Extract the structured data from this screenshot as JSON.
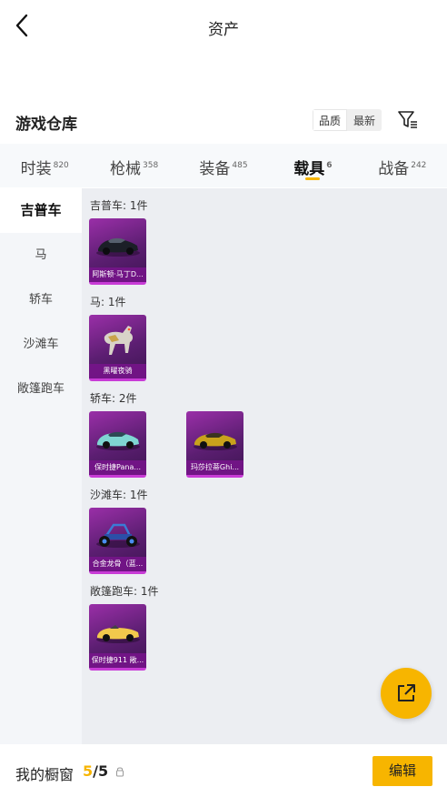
{
  "header": {
    "title": "资产"
  },
  "warehouse": {
    "title": "游戏仓库",
    "sort_quality": "品质",
    "sort_latest": "最新"
  },
  "tabs": [
    {
      "label": "时装",
      "count": "820"
    },
    {
      "label": "枪械",
      "count": "358"
    },
    {
      "label": "装备",
      "count": "485"
    },
    {
      "label": "载具",
      "count": "6"
    },
    {
      "label": "战备",
      "count": "242"
    }
  ],
  "sidebar": {
    "items": [
      "吉普车",
      "马",
      "轿车",
      "沙滩车",
      "敞篷跑车"
    ]
  },
  "groups": [
    {
      "label": "吉普车: 1件",
      "items": [
        {
          "name": "阿斯顿·马丁D...",
          "icon": "dark-sports-car-icon"
        }
      ]
    },
    {
      "label": "马: 1件",
      "items": [
        {
          "name": "黑曜夜骑",
          "icon": "horse-icon"
        }
      ]
    },
    {
      "label": "轿车: 2件",
      "items": [
        {
          "name": "保时捷Pana...",
          "icon": "teal-car-icon"
        },
        {
          "name": "玛莎拉蒂Ghi...",
          "icon": "gold-car-icon"
        }
      ]
    },
    {
      "label": "沙滩车: 1件",
      "items": [
        {
          "name": "合金龙骨（蓝...",
          "icon": "buggy-icon"
        }
      ]
    },
    {
      "label": "敞篷跑车: 1件",
      "items": [
        {
          "name": "保时捷911 敞...",
          "icon": "yellow-convertible-icon"
        }
      ]
    }
  ],
  "showcase": {
    "label": "我的橱窗",
    "current": "5",
    "total": "/5"
  },
  "actions": {
    "edit": "编辑"
  },
  "colors": {
    "accent": "#f7b500",
    "card_purple": "#9a2fa8"
  }
}
